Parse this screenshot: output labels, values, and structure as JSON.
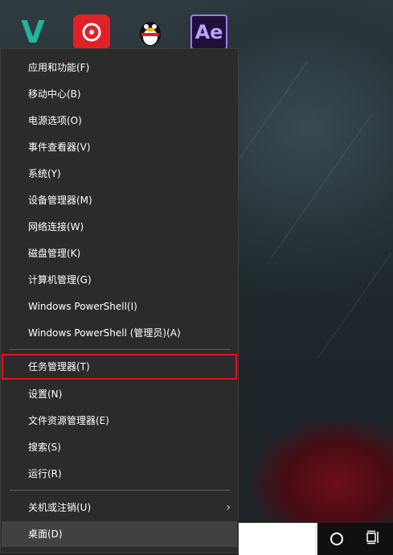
{
  "desktop": {
    "icons": [
      {
        "name": "v-app",
        "glyph": "V"
      },
      {
        "name": "netease-music",
        "glyph": ""
      },
      {
        "name": "qq",
        "glyph": ""
      },
      {
        "name": "after-effects",
        "glyph": "Ae"
      }
    ]
  },
  "menu": {
    "items": [
      {
        "label": "应用和功能(F)"
      },
      {
        "label": "移动中心(B)"
      },
      {
        "label": "电源选项(O)"
      },
      {
        "label": "事件查看器(V)"
      },
      {
        "label": "系统(Y)"
      },
      {
        "label": "设备管理器(M)"
      },
      {
        "label": "网络连接(W)"
      },
      {
        "label": "磁盘管理(K)"
      },
      {
        "label": "计算机管理(G)"
      },
      {
        "label": "Windows PowerShell(I)"
      },
      {
        "label": "Windows PowerShell (管理员)(A)"
      },
      {
        "label": "任务管理器(T)"
      },
      {
        "label": "设置(N)"
      },
      {
        "label": "文件资源管理器(E)"
      },
      {
        "label": "搜索(S)"
      },
      {
        "label": "运行(R)"
      },
      {
        "label": "关机或注销(U)"
      },
      {
        "label": "桌面(D)"
      }
    ],
    "highlight_color": "#e0111b"
  },
  "taskbar": {
    "icons": [
      "cortana-circle-icon",
      "task-view-icon"
    ]
  }
}
